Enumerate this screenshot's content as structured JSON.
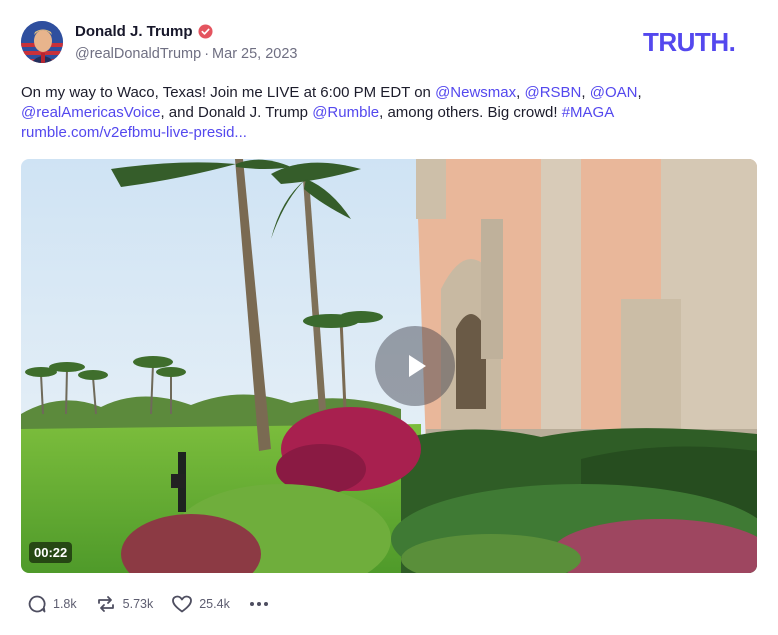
{
  "post": {
    "author": {
      "name": "Donald J. Trump",
      "handle": "@realDonaldTrump",
      "date": "Mar 25, 2023",
      "separator": "·",
      "verified": true,
      "avatar_icon": "avatar-portrait-flag-icon"
    },
    "brand": {
      "logo_text": "TRUTH.",
      "color": "#5448ee"
    },
    "text": {
      "part1": "On my way to Waco, Texas! Join me LIVE at 6:00 PM EDT on ",
      "mention1": "@Newsmax",
      "sep1": ", ",
      "mention2": "@RSBN",
      "sep2": ", ",
      "mention3": "@OAN",
      "sep3": ",",
      "mention4": "@realAmericasVoice",
      "part2": ", and Donald J. Trump ",
      "mention5": "@Rumble",
      "part3": ", among others. Big crowd! ",
      "hashtag": "#MAGA",
      "link": "rumble.com/v2efbmu-live-presid..."
    },
    "video": {
      "duration": "00:22",
      "play_icon": "play-icon"
    },
    "actions": {
      "replies": "1.8k",
      "retruths": "5.73k",
      "likes": "25.4k",
      "reply_icon": "reply-icon",
      "retruth_icon": "retruth-icon",
      "like_icon": "heart-icon",
      "more_icon": "more-icon"
    }
  }
}
